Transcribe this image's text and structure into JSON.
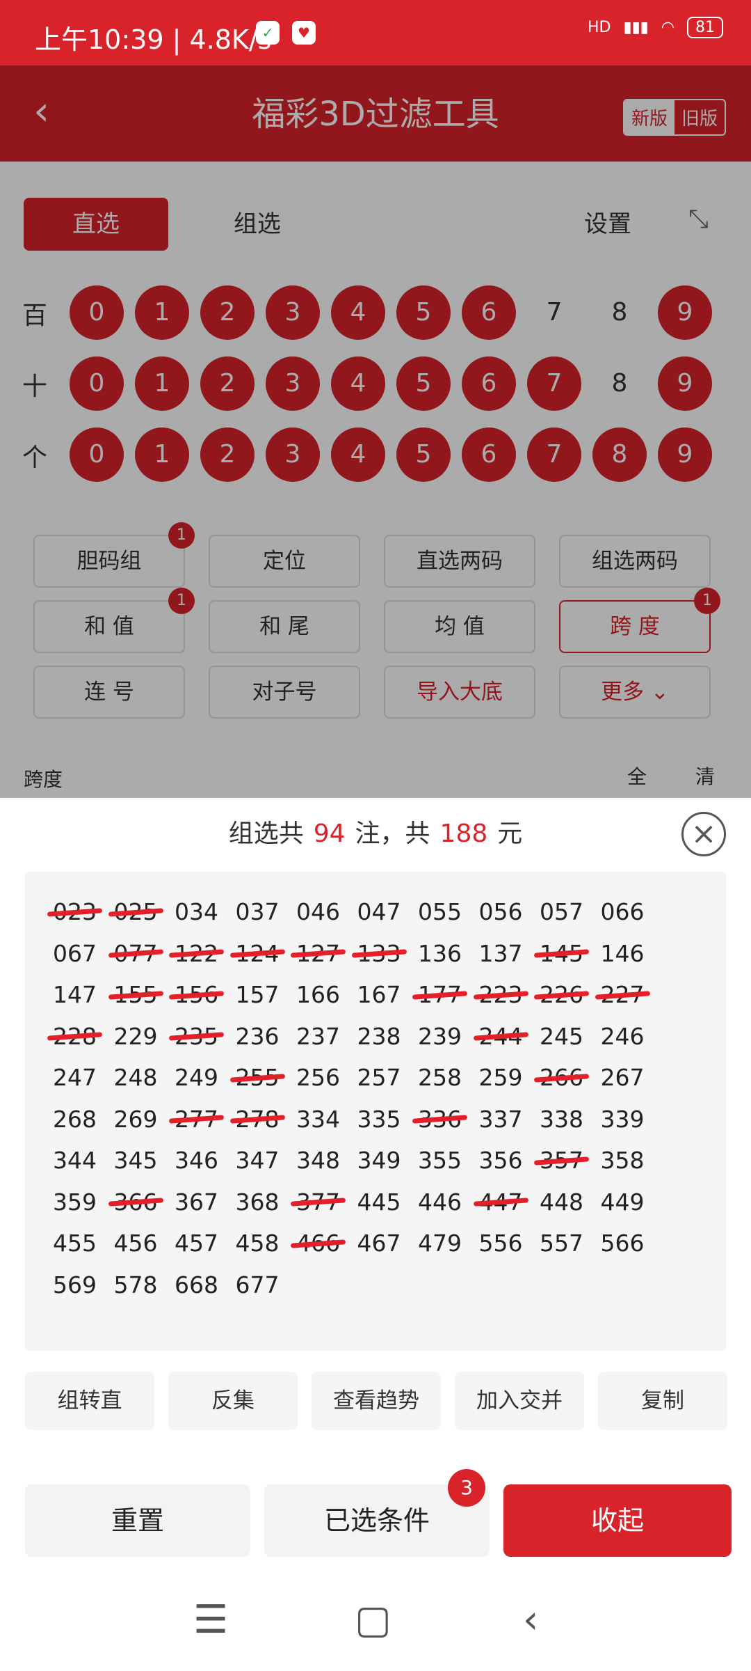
{
  "status": {
    "time": "上午10:39 | 4.8K/s",
    "signal": "HD",
    "battery": "81"
  },
  "header": {
    "title": "福彩3D过滤工具",
    "new_version": "新版",
    "old_version": "旧版"
  },
  "tabs": {
    "direct": "直选",
    "group": "组选",
    "settings": "设置"
  },
  "rows": [
    {
      "label": "百",
      "balls": [
        {
          "n": "0",
          "s": true
        },
        {
          "n": "1",
          "s": true
        },
        {
          "n": "2",
          "s": true
        },
        {
          "n": "3",
          "s": true
        },
        {
          "n": "4",
          "s": true
        },
        {
          "n": "5",
          "s": true
        },
        {
          "n": "6",
          "s": true
        },
        {
          "n": "7",
          "s": false
        },
        {
          "n": "8",
          "s": false
        },
        {
          "n": "9",
          "s": true
        }
      ]
    },
    {
      "label": "十",
      "balls": [
        {
          "n": "0",
          "s": true
        },
        {
          "n": "1",
          "s": true
        },
        {
          "n": "2",
          "s": true
        },
        {
          "n": "3",
          "s": true
        },
        {
          "n": "4",
          "s": true
        },
        {
          "n": "5",
          "s": true
        },
        {
          "n": "6",
          "s": true
        },
        {
          "n": "7",
          "s": true
        },
        {
          "n": "8",
          "s": false
        },
        {
          "n": "9",
          "s": true
        }
      ]
    },
    {
      "label": "个",
      "balls": [
        {
          "n": "0",
          "s": true
        },
        {
          "n": "1",
          "s": true
        },
        {
          "n": "2",
          "s": true
        },
        {
          "n": "3",
          "s": true
        },
        {
          "n": "4",
          "s": true
        },
        {
          "n": "5",
          "s": true
        },
        {
          "n": "6",
          "s": true
        },
        {
          "n": "7",
          "s": true
        },
        {
          "n": "8",
          "s": true
        },
        {
          "n": "9",
          "s": true
        }
      ]
    }
  ],
  "filters": [
    {
      "label": "胆码组",
      "badge": "1"
    },
    {
      "label": "定位"
    },
    {
      "label": "直选两码"
    },
    {
      "label": "组选两码"
    },
    {
      "label": "和 值",
      "badge": "1"
    },
    {
      "label": "和 尾"
    },
    {
      "label": "均 值"
    },
    {
      "label": "跨 度",
      "badge": "1",
      "active": true
    },
    {
      "label": "连 号"
    },
    {
      "label": "对子号"
    },
    {
      "label": "导入大底",
      "red": true
    },
    {
      "label": "更多 ⌄",
      "red": true
    }
  ],
  "span_section": {
    "label": "跨度",
    "all": "全",
    "clear": "清"
  },
  "result": {
    "prefix": "组选共",
    "count": "94",
    "mid": "注，共",
    "amount": "188",
    "suffix": "元",
    "numbers": [
      "023",
      "025",
      "034",
      "037",
      "046",
      "047",
      "055",
      "056",
      "057",
      "066",
      "067",
      "077",
      "122",
      "124",
      "127",
      "133",
      "136",
      "137",
      "145",
      "146",
      "147",
      "155",
      "156",
      "157",
      "166",
      "167",
      "177",
      "223",
      "226",
      "227",
      "228",
      "229",
      "235",
      "236",
      "237",
      "238",
      "239",
      "244",
      "245",
      "246",
      "247",
      "248",
      "249",
      "255",
      "256",
      "257",
      "258",
      "259",
      "266",
      "267",
      "268",
      "269",
      "277",
      "278",
      "334",
      "335",
      "336",
      "337",
      "338",
      "339",
      "344",
      "345",
      "346",
      "347",
      "348",
      "349",
      "355",
      "356",
      "357",
      "358",
      "359",
      "366",
      "367",
      "368",
      "377",
      "445",
      "446",
      "447",
      "448",
      "449",
      "455",
      "456",
      "457",
      "458",
      "466",
      "467",
      "479",
      "556",
      "557",
      "566",
      "569",
      "578",
      "668",
      "677"
    ],
    "crossed": [
      "023",
      "025",
      "077",
      "122",
      "124",
      "127",
      "133",
      "145",
      "155",
      "156",
      "177",
      "223",
      "226",
      "227",
      "228",
      "235",
      "244",
      "255",
      "266",
      "277",
      "278",
      "336",
      "357",
      "366",
      "377",
      "447",
      "466"
    ]
  },
  "actions": [
    "组转直",
    "反集",
    "查看趋势",
    "加入交并",
    "复制"
  ],
  "bottom": {
    "reset": "重置",
    "selected": "已选条件",
    "selected_count": "3",
    "collapse": "收起"
  },
  "nav_icons": [
    "menu-icon",
    "home-icon",
    "back-icon"
  ]
}
